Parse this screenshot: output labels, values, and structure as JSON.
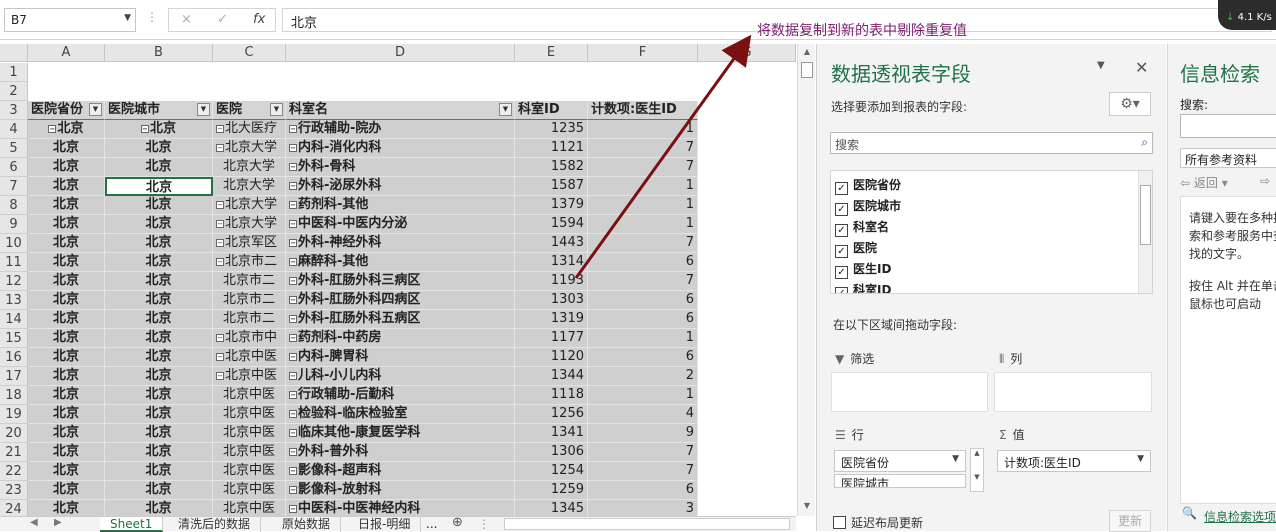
{
  "formula_bar": {
    "name_box": "B7",
    "cancel_icon": "×",
    "enter_icon": "✓",
    "fx_label": "fx",
    "formula": "北京"
  },
  "annotation": "将数据复制到新的表中剔除重复值",
  "network_widget": {
    "speed": "4.1 K/s"
  },
  "columns": [
    "A",
    "B",
    "C",
    "D",
    "E",
    "F",
    "G"
  ],
  "row_numbers": [
    "1",
    "2",
    "3",
    "4",
    "5",
    "6",
    "7",
    "8",
    "9",
    "10",
    "11",
    "12",
    "13",
    "14",
    "15",
    "16",
    "17",
    "18",
    "19",
    "20",
    "21",
    "22",
    "23",
    "24"
  ],
  "pivot_headers": [
    "医院省份",
    "医院城市",
    "医院",
    "科室名",
    "科室ID",
    "计数项:医生ID"
  ],
  "pivot_rows": [
    {
      "province": "北京",
      "city": "北京",
      "hospital": "北大医疗",
      "dept": "行政辅助-院办",
      "id": "1235",
      "count": "1",
      "p_exp": true,
      "c_exp": true,
      "h_exp": true
    },
    {
      "province": "北京",
      "city": "北京",
      "hospital": "北京大学",
      "dept": "内科-消化内科",
      "id": "1121",
      "count": "7",
      "h_exp": true
    },
    {
      "province": "北京",
      "city": "北京",
      "hospital": "北京大学",
      "dept": "外科-骨科",
      "id": "1582",
      "count": "7"
    },
    {
      "province": "北京",
      "city": "北京",
      "hospital": "北京大学",
      "dept": "外科-泌尿外科",
      "id": "1587",
      "count": "1"
    },
    {
      "province": "北京",
      "city": "北京",
      "hospital": "北京大学",
      "dept": "药剂科-其他",
      "id": "1379",
      "count": "1",
      "h_exp": true
    },
    {
      "province": "北京",
      "city": "北京",
      "hospital": "北京大学",
      "dept": "中医科-中医内分泌",
      "id": "1594",
      "count": "1",
      "h_exp": true
    },
    {
      "province": "北京",
      "city": "北京",
      "hospital": "北京军区",
      "dept": "外科-神经外科",
      "id": "1443",
      "count": "7",
      "h_exp": true
    },
    {
      "province": "北京",
      "city": "北京",
      "hospital": "北京市二",
      "dept": "麻醉科-其他",
      "id": "1314",
      "count": "6",
      "h_exp": true
    },
    {
      "province": "北京",
      "city": "北京",
      "hospital": "北京市二",
      "dept": "外科-肛肠外科三病区",
      "id": "1193",
      "count": "7"
    },
    {
      "province": "北京",
      "city": "北京",
      "hospital": "北京市二",
      "dept": "外科-肛肠外科四病区",
      "id": "1303",
      "count": "6"
    },
    {
      "province": "北京",
      "city": "北京",
      "hospital": "北京市二",
      "dept": "外科-肛肠外科五病区",
      "id": "1319",
      "count": "6"
    },
    {
      "province": "北京",
      "city": "北京",
      "hospital": "北京市中",
      "dept": "药剂科-中药房",
      "id": "1177",
      "count": "1",
      "h_exp": true
    },
    {
      "province": "北京",
      "city": "北京",
      "hospital": "北京中医",
      "dept": "内科-脾胃科",
      "id": "1120",
      "count": "6",
      "h_exp": true
    },
    {
      "province": "北京",
      "city": "北京",
      "hospital": "北京中医",
      "dept": "儿科-小儿内科",
      "id": "1344",
      "count": "2",
      "h_exp": true
    },
    {
      "province": "北京",
      "city": "北京",
      "hospital": "北京中医",
      "dept": "行政辅助-后勤科",
      "id": "1118",
      "count": "1"
    },
    {
      "province": "北京",
      "city": "北京",
      "hospital": "北京中医",
      "dept": "检验科-临床检验室",
      "id": "1256",
      "count": "4"
    },
    {
      "province": "北京",
      "city": "北京",
      "hospital": "北京中医",
      "dept": "临床其他-康复医学科",
      "id": "1341",
      "count": "9"
    },
    {
      "province": "北京",
      "city": "北京",
      "hospital": "北京中医",
      "dept": "外科-普外科",
      "id": "1306",
      "count": "7"
    },
    {
      "province": "北京",
      "city": "北京",
      "hospital": "北京中医",
      "dept": "影像科-超声科",
      "id": "1254",
      "count": "7"
    },
    {
      "province": "北京",
      "city": "北京",
      "hospital": "北京中医",
      "dept": "影像科-放射科",
      "id": "1259",
      "count": "6"
    },
    {
      "province": "北京",
      "city": "北京",
      "hospital": "北京中医",
      "dept": "中医科-中医神经内科",
      "id": "1345",
      "count": "3"
    }
  ],
  "tabs": [
    "Sheet1",
    "清洗后的数据",
    "原始数据",
    "日报-明细",
    "..."
  ],
  "pivot_panel": {
    "title": "数据透视表字段",
    "subtitle": "选择要添加到报表的字段:",
    "search_placeholder": "搜索",
    "fields": [
      "医院省份",
      "医院城市",
      "科室名",
      "医院",
      "医生ID",
      "科室ID"
    ],
    "drag_hint": "在以下区域间拖动字段:",
    "filter_label": "筛选",
    "column_label": "列",
    "row_label": "行",
    "value_label": "值",
    "row_field_1": "医院省份",
    "row_field_2": "医院城市",
    "value_field": "计数项:医生ID",
    "defer_label": "延迟布局更新",
    "update_button": "更新"
  },
  "info_panel": {
    "title": "信息检索",
    "search_label": "搜索:",
    "source": "所有参考资料",
    "back": "返回",
    "body_1": "请键入要在多种搜索和参考服务中查找的文字。",
    "body_2": "按住 Alt 并在单击鼠标也可启动",
    "link": "信息检索选项"
  }
}
